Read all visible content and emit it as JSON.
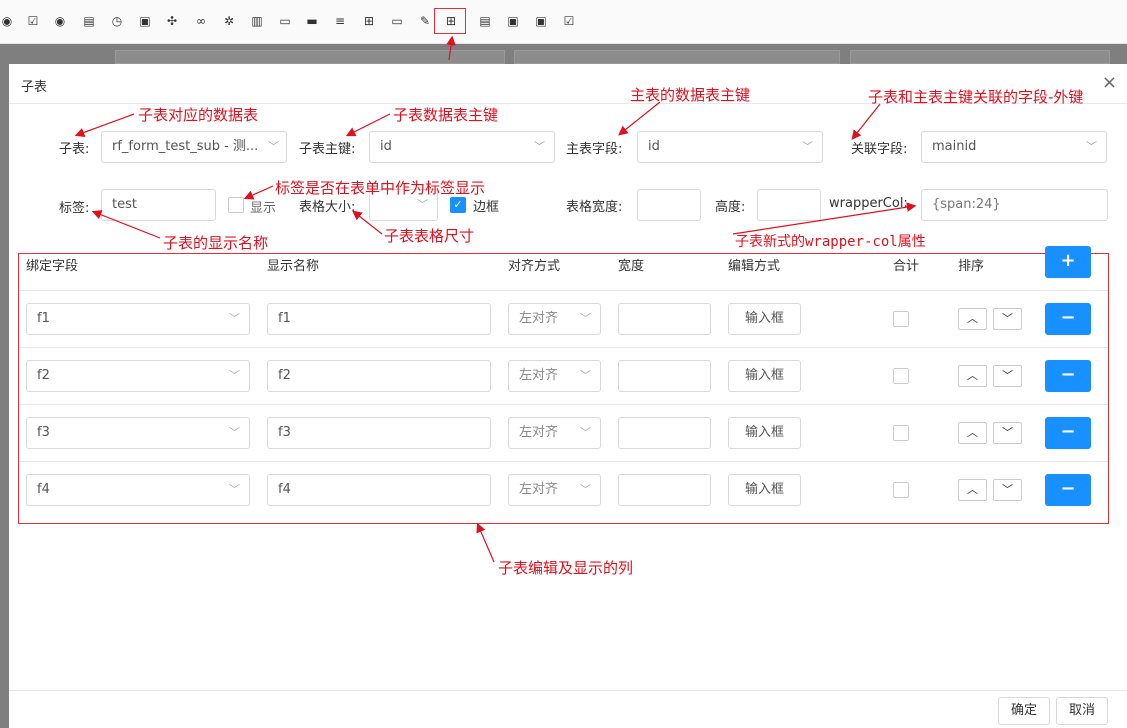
{
  "modal": {
    "title": "子表",
    "close": "×",
    "ok": "确定",
    "cancel": "取消"
  },
  "form": {
    "subtable_label": "子表:",
    "subtable_value": "rf_form_test_sub - 测...",
    "sub_pk_label": "子表主键:",
    "sub_pk_value": "id",
    "main_field_label": "主表字段:",
    "main_field_value": "id",
    "link_field_label": "关联字段:",
    "link_field_value": "mainid",
    "tag_label": "标签:",
    "tag_value": "test",
    "show_label": "显示",
    "size_label": "表格大小:",
    "size_value": "",
    "border_label": "边框",
    "width_label": "表格宽度:",
    "width_value": "",
    "height_label": "高度:",
    "height_value": "",
    "wrapper_label": "wrapperCol:",
    "wrapper_value": "{span:24}"
  },
  "table": {
    "headers": [
      "绑定字段",
      "显示名称",
      "对齐方式",
      "宽度",
      "编辑方式",
      "合计",
      "排序"
    ],
    "add": "+",
    "rows": [
      {
        "field": "f1",
        "name": "f1",
        "align": "左对齐",
        "edit": "输入框"
      },
      {
        "field": "f2",
        "name": "f2",
        "align": "左对齐",
        "edit": "输入框"
      },
      {
        "field": "f3",
        "name": "f3",
        "align": "左对齐",
        "edit": "输入框"
      },
      {
        "field": "f4",
        "name": "f4",
        "align": "左对齐",
        "edit": "输入框"
      }
    ],
    "remove": "−"
  },
  "annotations": {
    "a1": "子表对应的数据表",
    "a2": "子表数据表主键",
    "a3": "主表的数据表主键",
    "a4": "子表和主表主键关联的字段-外键",
    "a5": "标签是否在表单中作为标签显示",
    "a6": "子表的显示名称",
    "a7": "子表表格尺寸",
    "a8": "子表新式的wrapper-col属性",
    "a9": "子表编辑及显示的列"
  },
  "colors": {
    "accent": "#1890ff",
    "annotation": "#e0101e"
  }
}
